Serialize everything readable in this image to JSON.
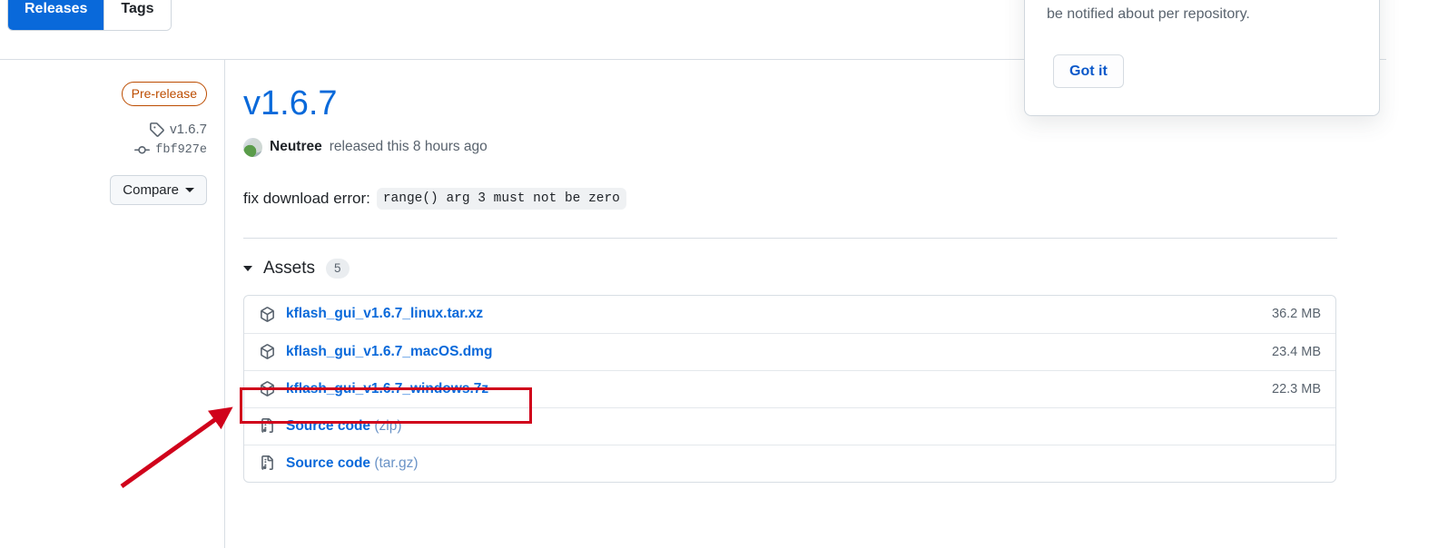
{
  "tabs": [
    {
      "label": "Releases",
      "selected": true
    },
    {
      "label": "Tags",
      "selected": false
    }
  ],
  "sidebar": {
    "prerelease_badge": "Pre-release",
    "tag_icon": "tag-icon",
    "tag_name": "v1.6.7",
    "commit_icon": "commit-icon",
    "commit_sha": "fbf927e",
    "compare_label": "Compare"
  },
  "release": {
    "title": "v1.6.7",
    "avatar": "user-avatar",
    "author": "Neutree",
    "published": "released this 8 hours ago",
    "body_prefix": "fix download error:",
    "body_code": "range() arg 3 must not be zero"
  },
  "assets": {
    "heading": "Assets",
    "count": "5",
    "rows": [
      {
        "icon": "package-icon",
        "name": "kflash_gui_v1.6.7_linux.tar.xz",
        "suffix": "",
        "size": "36.2 MB"
      },
      {
        "icon": "package-icon",
        "name": "kflash_gui_v1.6.7_macOS.dmg",
        "suffix": "",
        "size": "23.4 MB"
      },
      {
        "icon": "package-icon",
        "name": "kflash_gui_v1.6.7_windows.7z",
        "suffix": "",
        "size": "22.3 MB"
      },
      {
        "icon": "file-zip-icon",
        "name": "Source code",
        "suffix": " (zip)",
        "size": ""
      },
      {
        "icon": "file-zip-icon",
        "name": "Source code",
        "suffix": " (tar.gz)",
        "size": ""
      }
    ]
  },
  "popover": {
    "text": "can choose which types of activity you'd like to be notified about per repository.",
    "button_label": "Got it"
  },
  "annotation": {
    "highlight_target": "kflash_gui_v1.6.7_windows.7z",
    "color": "#d0021b"
  },
  "colors": {
    "accent_blue": "#0969da",
    "prerelease_orange": "#bc4c00",
    "muted_gray": "#59636e",
    "border": "#d8dee4",
    "annotation_red": "#d0021b"
  }
}
